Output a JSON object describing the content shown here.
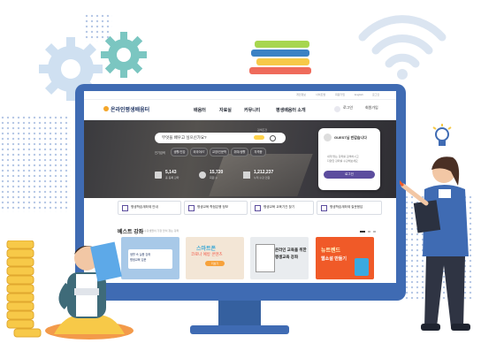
{
  "site": {
    "logo": "온라인평생배움터",
    "topbar": [
      "개인정보",
      "사이트맵",
      "회원가입",
      "English",
      "로그인"
    ],
    "nav": [
      "배움터",
      "자료실",
      "커뮤니티",
      "평생배움터 소개"
    ],
    "login_pill": "로그인",
    "join_link": "회원가입"
  },
  "hero": {
    "search_placeholder": "무엇을 배우고 싶으신가요?",
    "toggle_label": "검색조건",
    "chips": [
      "인기검색",
      "생활/건강",
      "외국어/IT",
      "교양/인문학",
      "취미/생활",
      "자격증"
    ],
    "stats": [
      {
        "value": "5,143",
        "label": "총 등록 강좌"
      },
      {
        "value": "15,720",
        "label": "회원 수"
      },
      {
        "value": "1,212,237",
        "label": "누적 수강 인원"
      }
    ],
    "login_card": {
      "greeting": "GUEST님 반갑습니다",
      "desc_line1": "내게 맞는 강좌를 검색하시고",
      "desc_line2": "다양한 강좌를 수강해보세요",
      "button": "로그인"
    }
  },
  "quick_links": [
    "평생학습계좌제 안내",
    "평생교육 학점은행 정보",
    "평생교육 교육기관 찾기",
    "평생학습계좌제 질문응답"
  ],
  "best": {
    "title": "베스트 강좌",
    "subtitle": "수강생들이 가장 많이 찾는 강좌",
    "cards": [
      {
        "line1": "생활 속 실용 강좌",
        "line2": "평생교육 입문",
        "bg": "#a8c9e8"
      },
      {
        "line1": "스마트폰",
        "line2": "코로나 예방 콘텐츠",
        "btn": "더보기",
        "bg": "#f3e6d6"
      },
      {
        "line1": "온라인 교육을 위한",
        "line2": "평생교육 강좌",
        "bg": "#e9ecef"
      },
      {
        "line1": "뉴트렌드",
        "line2": "웹소설 만들기",
        "bg": "#f05a28"
      }
    ]
  },
  "colors": {
    "monitor": "#3f6bb3",
    "accent": "#5c4d9e",
    "gear": "#b5d3ef"
  }
}
